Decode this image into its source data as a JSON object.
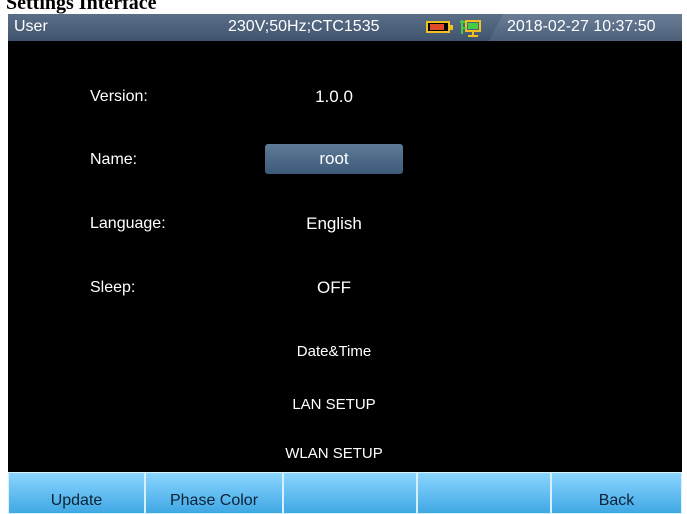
{
  "page": {
    "caption": "Settings Interface"
  },
  "statusbar": {
    "user": "User",
    "power": "230V;50Hz;CTC1535",
    "datetime": "2018-02-27 10:37:50",
    "battery_icon": "battery-icon",
    "network_icon": "network-icon",
    "battery_color": "#e04a28"
  },
  "settings": {
    "version": {
      "label": "Version:",
      "value": "1.0.0"
    },
    "name": {
      "label": "Name:",
      "value": "root"
    },
    "language": {
      "label": "Language:",
      "value": "English"
    },
    "sleep": {
      "label": "Sleep:",
      "value": "OFF"
    },
    "links": {
      "datetime": "Date&Time",
      "lan": "LAN SETUP",
      "wlan": "WLAN SETUP"
    }
  },
  "softkeys": {
    "k1": "Update",
    "k2": "Phase Color",
    "k3": "",
    "k4": "",
    "k5": "Back"
  }
}
